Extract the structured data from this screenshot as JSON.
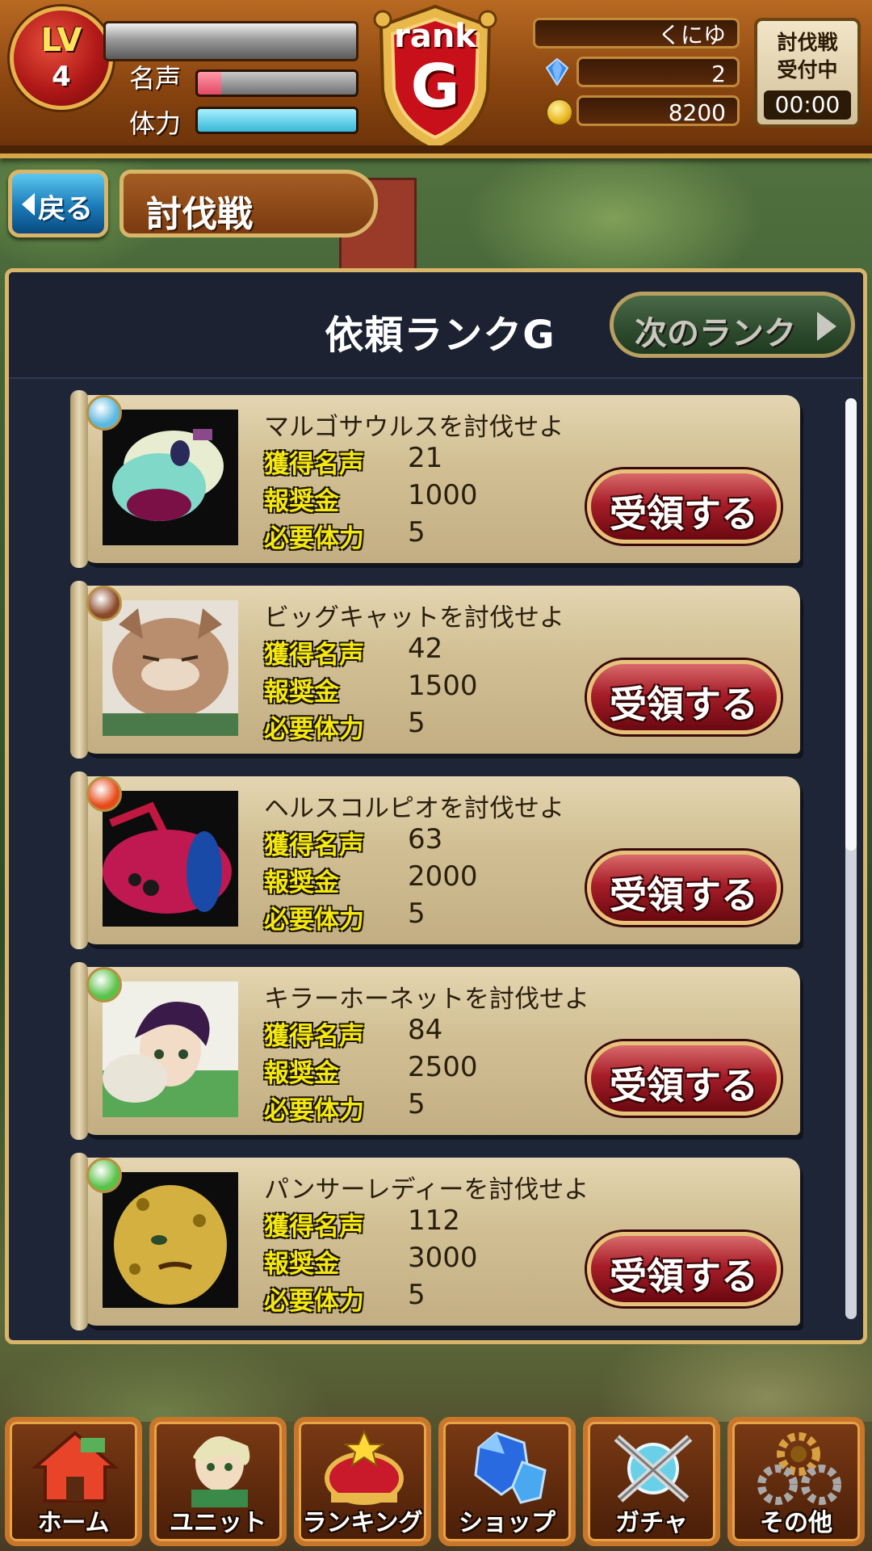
{
  "status": {
    "level_label": "LV",
    "level": "4",
    "fame_label": "名声",
    "fame_fill": 0.15,
    "stamina_label": "体力",
    "stamina_fill": 1.0,
    "rank_word": "rank",
    "rank_letter": "G",
    "player_name": "くにゆ",
    "gems": "2",
    "coins": "8200",
    "battle_status": "討伐戦\n受付中",
    "battle_status_line1": "討伐戦",
    "battle_status_line2": "受付中",
    "battle_timer": "00:00"
  },
  "header": {
    "back_label": "戻る",
    "title": "討伐戦"
  },
  "panel": {
    "title": "依頼ランクG",
    "next_rank_label": "次のランク"
  },
  "labels": {
    "fame_gain": "獲得名声",
    "reward": "報奨金",
    "stamina_cost": "必要体力",
    "accept": "受領する"
  },
  "quests": [
    {
      "title": "マルゴサウルスを討伐せよ",
      "fame": "21",
      "reward": "1000",
      "stamina": "5",
      "element_color": "#5ab8e0",
      "portrait": "maru-gosaurus"
    },
    {
      "title": "ビッグキャットを討伐せよ",
      "fame": "42",
      "reward": "1500",
      "stamina": "5",
      "element_color": "#8a4a2a",
      "portrait": "big-cat"
    },
    {
      "title": "ヘルスコルピオを討伐せよ",
      "fame": "63",
      "reward": "2000",
      "stamina": "5",
      "element_color": "#e84a1a",
      "portrait": "hell-scorpio"
    },
    {
      "title": "キラーホーネットを討伐せよ",
      "fame": "84",
      "reward": "2500",
      "stamina": "5",
      "element_color": "#5ac24a",
      "portrait": "killer-hornet"
    },
    {
      "title": "パンサーレディーを討伐せよ",
      "fame": "112",
      "reward": "3000",
      "stamina": "5",
      "element_color": "#5ac24a",
      "portrait": "panther-lady"
    }
  ],
  "nav": [
    {
      "label": "ホーム",
      "icon": "home-icon"
    },
    {
      "label": "ユニット",
      "icon": "unit-icon"
    },
    {
      "label": "ランキング",
      "icon": "crown-icon"
    },
    {
      "label": "ショップ",
      "icon": "gem-icon"
    },
    {
      "label": "ガチャ",
      "icon": "crossed-swords-icon"
    },
    {
      "label": "その他",
      "icon": "gear-icon"
    }
  ],
  "colors": {
    "accent_gold": "#d9b56a",
    "panel_bg": "#1e2536",
    "accept_red": "#a81e2a",
    "label_yellow": "#f5e810"
  }
}
